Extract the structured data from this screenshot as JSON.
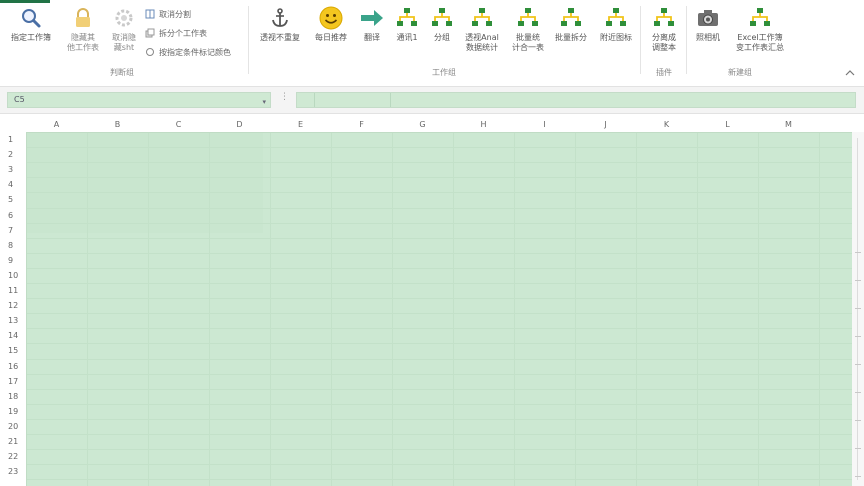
{
  "ribbon": {
    "buttons": [
      {
        "id": "view-sheet",
        "label": "指定工作簿",
        "icon": "magnifier-icon"
      },
      {
        "id": "lock-sheet",
        "label": "隐藏其\n他工作表",
        "icon": "lock-icon"
      },
      {
        "id": "gear",
        "label": "取消隐\n藏sht",
        "icon": "gear-icon"
      },
      {
        "id": "anchor",
        "label": "透视不重复",
        "icon": "anchor-icon"
      },
      {
        "id": "smile",
        "label": "每日推荐",
        "icon": "smiley-icon"
      },
      {
        "id": "arrow",
        "label": "翻译",
        "icon": "arrow-right-icon"
      },
      {
        "id": "hier1",
        "label": "通讯1",
        "icon": "hierarchy-icon"
      },
      {
        "id": "hier2",
        "label": "分组",
        "icon": "hierarchy-icon"
      },
      {
        "id": "hier3",
        "label": "透视Anal\n数据统计",
        "icon": "hierarchy-icon"
      },
      {
        "id": "hier4",
        "label": "批量统\n计合一表",
        "icon": "hierarchy-icon"
      },
      {
        "id": "hier5",
        "label": "批量拆分",
        "icon": "hierarchy-icon"
      },
      {
        "id": "hier6",
        "label": "附近图标",
        "icon": "hierarchy-icon"
      },
      {
        "id": "hier7",
        "label": "分离成\n调整本",
        "icon": "hierarchy-icon"
      },
      {
        "id": "camera",
        "label": "照相机",
        "icon": "camera-icon"
      },
      {
        "id": "hier8",
        "label": "Excel工作簿\n变工作表汇总",
        "icon": "hierarchy-icon"
      }
    ],
    "small_buttons": [
      {
        "label": "取消分割",
        "icon": "split-icon"
      },
      {
        "label": "拆分个工作表",
        "icon": "sheets-icon"
      },
      {
        "label": "按指定条件标记颜色",
        "icon": "marker-icon"
      }
    ],
    "groups": [
      {
        "label": "判断组"
      },
      {
        "label": "工作组"
      },
      {
        "label": "插件"
      },
      {
        "label": "新建组"
      }
    ]
  },
  "formula_bar": {
    "name_box_value": "C5",
    "fx_separator": "⋮",
    "dropdown_glyph": "▾"
  },
  "sheet": {
    "columns": [
      "A",
      "B",
      "C",
      "D",
      "E",
      "F",
      "G",
      "H",
      "I",
      "J",
      "K",
      "L",
      "M"
    ],
    "rows": [
      "1",
      "2",
      "3",
      "4",
      "5",
      "6",
      "7",
      "8",
      "9",
      "10",
      "11",
      "12",
      "13",
      "14",
      "15",
      "16",
      "17",
      "18",
      "19",
      "20",
      "21",
      "22",
      "23"
    ]
  },
  "colors": {
    "accent": "#217346",
    "cell_fill": "#cce8d2",
    "icon_green": "#2e8b57",
    "icon_yellow": "#f0c419"
  }
}
